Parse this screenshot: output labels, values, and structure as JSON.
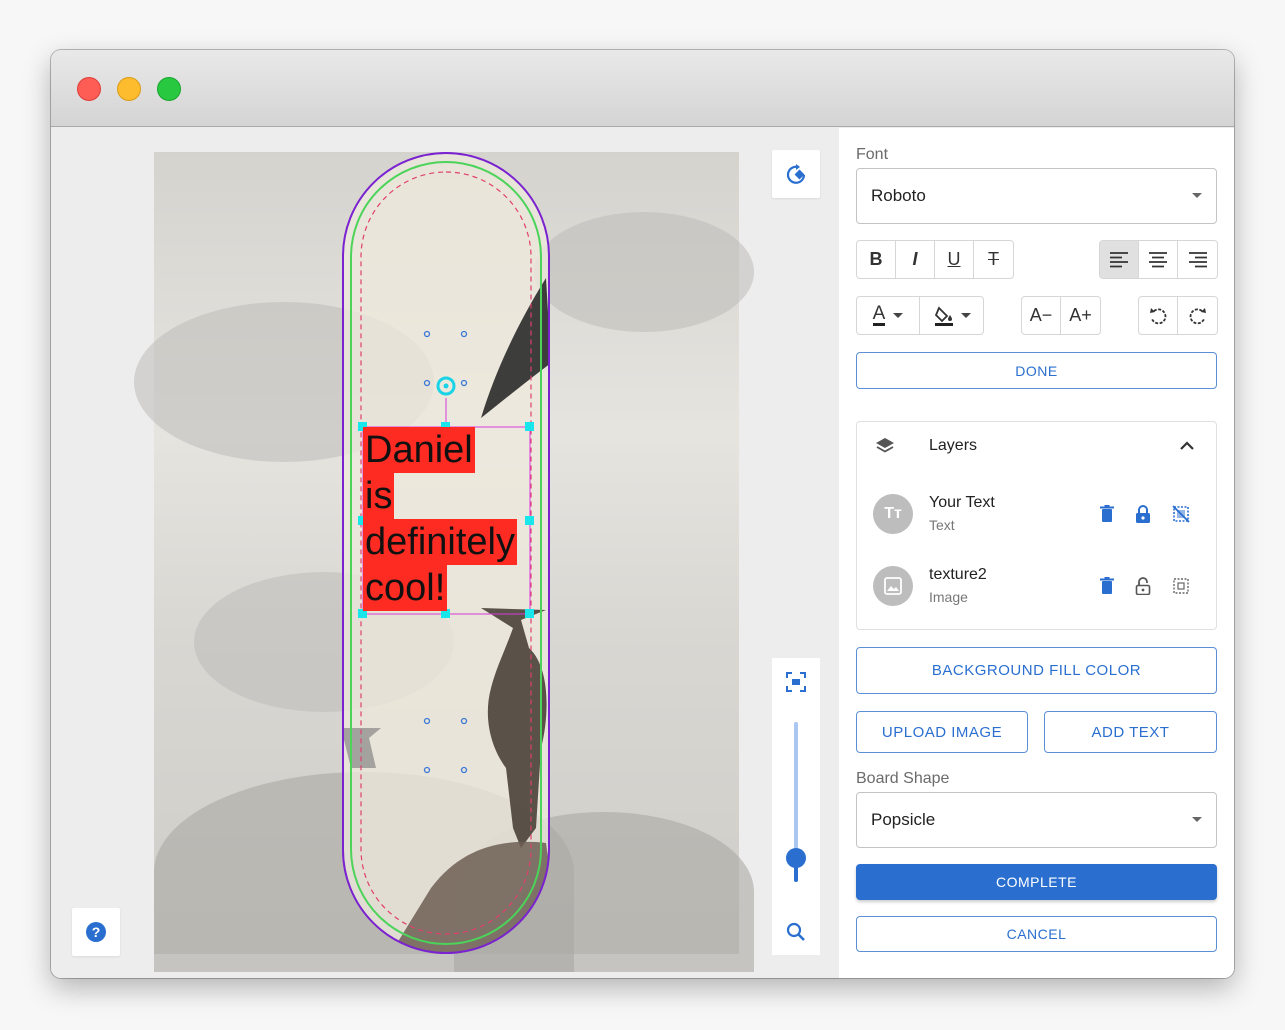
{
  "window": {
    "controls": [
      "close",
      "minimize",
      "maximize"
    ]
  },
  "canvas": {
    "text_lines": [
      "Daniel",
      "is",
      "definitely",
      "cool!"
    ],
    "text_bg_color": "#fd2b22",
    "rotate_tool_icon": "rotate-fill-icon",
    "help_icon": "help-icon",
    "zoom": {
      "level": 0.15,
      "fit_icon": "fit-screen-icon",
      "search_icon": "zoom-icon"
    }
  },
  "sidebar": {
    "font": {
      "label": "Font",
      "value": "Roboto"
    },
    "format": {
      "bold": "B",
      "italic": "I",
      "underline": "U",
      "strike": "T",
      "align": [
        "align-left-icon",
        "align-center-icon",
        "align-right-icon"
      ],
      "active_align": "left"
    },
    "color_tools": {
      "text_color": "A",
      "fill_color": "fill-bucket-icon"
    },
    "size_tools": {
      "decrease": "A−",
      "increase": "A+"
    },
    "done_label": "DONE",
    "layers": {
      "title": "Layers",
      "items": [
        {
          "name": "Your Text",
          "type": "Text",
          "avatar": "Tт",
          "locked": true
        },
        {
          "name": "texture2",
          "type": "Image",
          "avatar": "image",
          "locked": false
        }
      ]
    },
    "background_fill_label": "BACKGROUND FILL COLOR",
    "upload_image_label": "UPLOAD IMAGE",
    "add_text_label": "ADD TEXT",
    "board_shape": {
      "label": "Board Shape",
      "value": "Popsicle"
    },
    "complete_label": "COMPLETE",
    "cancel_label": "CANCEL",
    "accent_color": "#2a6fd0"
  }
}
